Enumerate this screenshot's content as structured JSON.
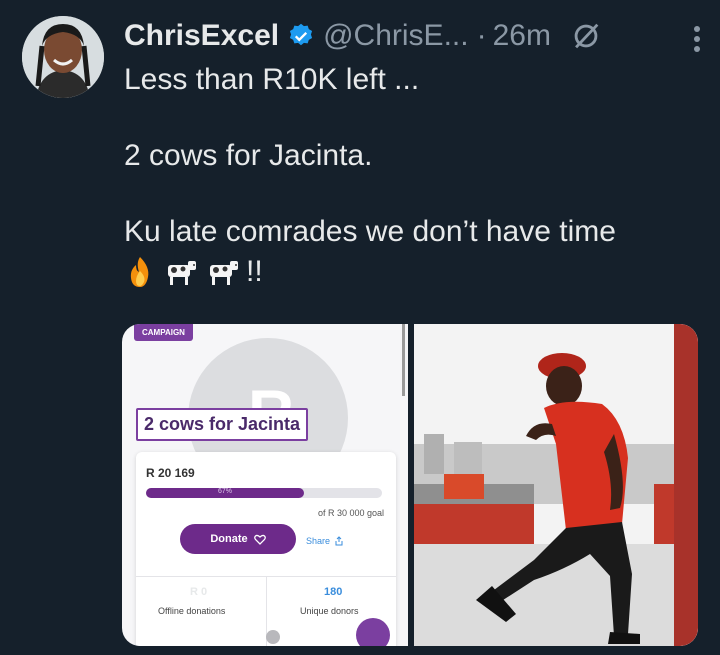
{
  "tweet": {
    "display_name": "ChrisExcel",
    "handle": "@ChrisE...",
    "separator": "·",
    "time": "26m",
    "lines": [
      "Less than R10K left ...",
      "2 cows for Jacinta.",
      "Ku late comrades we don’t have time"
    ],
    "emoji_suffix": "!!",
    "icons": [
      "verified-badge-icon",
      "grok-icon",
      "more-icon",
      "fire-emoji",
      "cow-emoji",
      "cow-emoji"
    ]
  },
  "campaign_screenshot": {
    "tag": "CAMPAIGN",
    "placeholder_letter": "R",
    "title": "2 cows for Jacinta",
    "raised": "R 20 169",
    "progress_percent": 67,
    "progress_label": "67%",
    "goal": "of R 30 000 goal",
    "donate_label": "Donate",
    "share_label": "Share",
    "offline_value": "R 0",
    "offline_label": "Offline donations",
    "unique_value": "180",
    "unique_label": "Unique donors"
  },
  "colors": {
    "background": "#15202b",
    "text": "#e7e9ea",
    "muted": "#8b98a5",
    "verified_blue": "#1d9bf0",
    "purple": "#6d2a8a"
  }
}
